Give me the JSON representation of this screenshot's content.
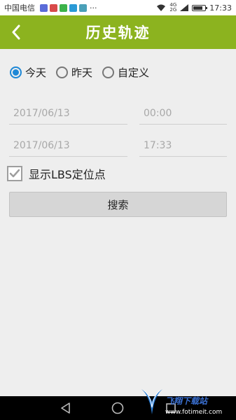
{
  "status_bar": {
    "carrier": "中国电信",
    "network_top": "4G",
    "network_bottom": "2G",
    "time": "17:33",
    "more": "···"
  },
  "header": {
    "title": "历史轨迹"
  },
  "range_options": [
    {
      "label": "今天",
      "checked": true
    },
    {
      "label": "昨天",
      "checked": false
    },
    {
      "label": "自定义",
      "checked": false
    }
  ],
  "start": {
    "date": "2017/06/13",
    "time": "00:00"
  },
  "end": {
    "date": "2017/06/13",
    "time": "17:33"
  },
  "lbs_checkbox": {
    "label": "显示LBS定位点",
    "checked": true
  },
  "search_button": {
    "label": "搜索"
  },
  "watermark": {
    "text": "飞翔下载站",
    "url": "www.fotimeit.com"
  },
  "colors": {
    "accent": "#8cb31f",
    "radio": "#1e88d6"
  }
}
